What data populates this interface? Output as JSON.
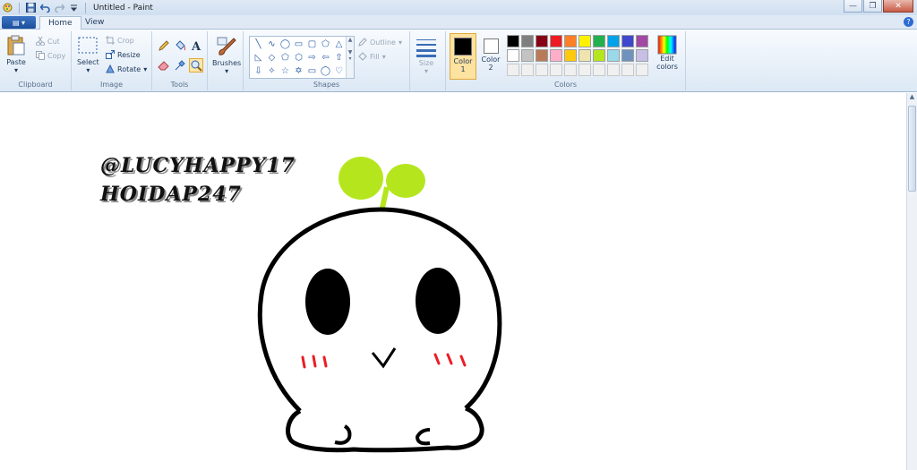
{
  "window": {
    "title": "Untitled - Paint",
    "controls": {
      "minimize": "—",
      "maximize": "❐",
      "close": "✕"
    },
    "help": "?"
  },
  "quick_access": [
    "save-icon",
    "undo-icon",
    "redo-icon",
    "dropdown-icon"
  ],
  "tabs": [
    {
      "label": "Home",
      "active": true
    },
    {
      "label": "View",
      "active": false
    }
  ],
  "ribbon": {
    "clipboard": {
      "label": "Clipboard",
      "paste": "Paste",
      "cut": "Cut",
      "copy": "Copy"
    },
    "image": {
      "label": "Image",
      "select": "Select",
      "crop": "Crop",
      "resize": "Resize",
      "rotate": "Rotate"
    },
    "tools": {
      "label": "Tools"
    },
    "brushes": {
      "label": "Brushes"
    },
    "shapes": {
      "label": "Shapes",
      "outline": "Outline",
      "fill": "Fill"
    },
    "size": {
      "label": "Size"
    },
    "colors": {
      "label": "Colors",
      "color1": "Color",
      "color1_num": "1",
      "color2": "Color",
      "color2_num": "2",
      "edit": "Edit",
      "edit2": "colors",
      "color1_value": "#000000",
      "color2_value": "#ffffff",
      "palette_row1": [
        "#000000",
        "#7f7f7f",
        "#880015",
        "#ed1c24",
        "#ff7f27",
        "#fff200",
        "#22b14c",
        "#00a2e8",
        "#3f48cc",
        "#a349a4"
      ],
      "palette_row2": [
        "#ffffff",
        "#c3c3c3",
        "#b97a57",
        "#ffaec9",
        "#ffc90e",
        "#efe4b0",
        "#b5e61d",
        "#99d9ea",
        "#7092be",
        "#c8bfe7"
      ],
      "palette_row3": [
        "#f0f0f0",
        "#f0f0f0",
        "#f0f0f0",
        "#f0f0f0",
        "#f0f0f0",
        "#f0f0f0",
        "#f0f0f0",
        "#f0f0f0",
        "#f0f0f0",
        "#f0f0f0"
      ]
    }
  },
  "canvas": {
    "text_line1": "@LUCYHAPPY17",
    "text_line2": "HOIDAP247",
    "drawing_colors": {
      "outline": "#000000",
      "sprout": "#b5e61d",
      "blush": "#ed1c24"
    }
  }
}
